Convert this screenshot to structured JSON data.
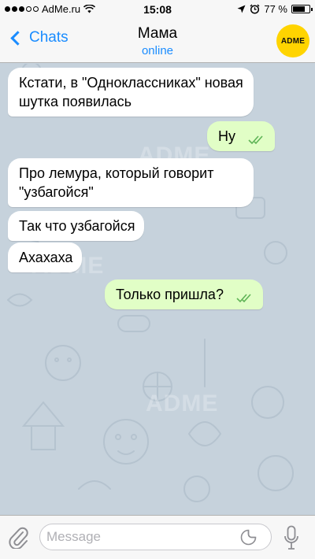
{
  "status_bar": {
    "carrier": "AdMe.ru",
    "time": "15:08",
    "battery_text": "77 %",
    "battery_level": 0.77,
    "signal_bars_filled": 3,
    "signal_bars_total": 5,
    "icons": [
      "wifi-icon",
      "location-arrow-icon",
      "alarm-clock-icon",
      "battery-icon"
    ]
  },
  "header": {
    "back_label": "Chats",
    "title": "Мама",
    "status": "online",
    "avatar_text": "ADME",
    "avatar_color": "#ffd400"
  },
  "messages": [
    {
      "direction": "incoming",
      "text": "Кстати, в \"Одноклассниках\" новая шутка появилась"
    },
    {
      "direction": "outgoing",
      "text": "Ну",
      "read": true
    },
    {
      "direction": "incoming",
      "text": "Про лемура, который говорит \"узбагойся\""
    },
    {
      "direction": "incoming",
      "text": "Так что узбагойся"
    },
    {
      "direction": "incoming",
      "text": "Ахахаха"
    },
    {
      "direction": "outgoing",
      "text": "Только пришла?",
      "read": true
    }
  ],
  "input": {
    "placeholder": "Message",
    "value": ""
  },
  "watermark": "ADME",
  "colors": {
    "accent": "#1a8cff",
    "outgoing_bubble": "#e1fec6",
    "incoming_bubble": "#ffffff",
    "read_checks": "#5fb456",
    "chat_background": "#c6d2dc"
  }
}
